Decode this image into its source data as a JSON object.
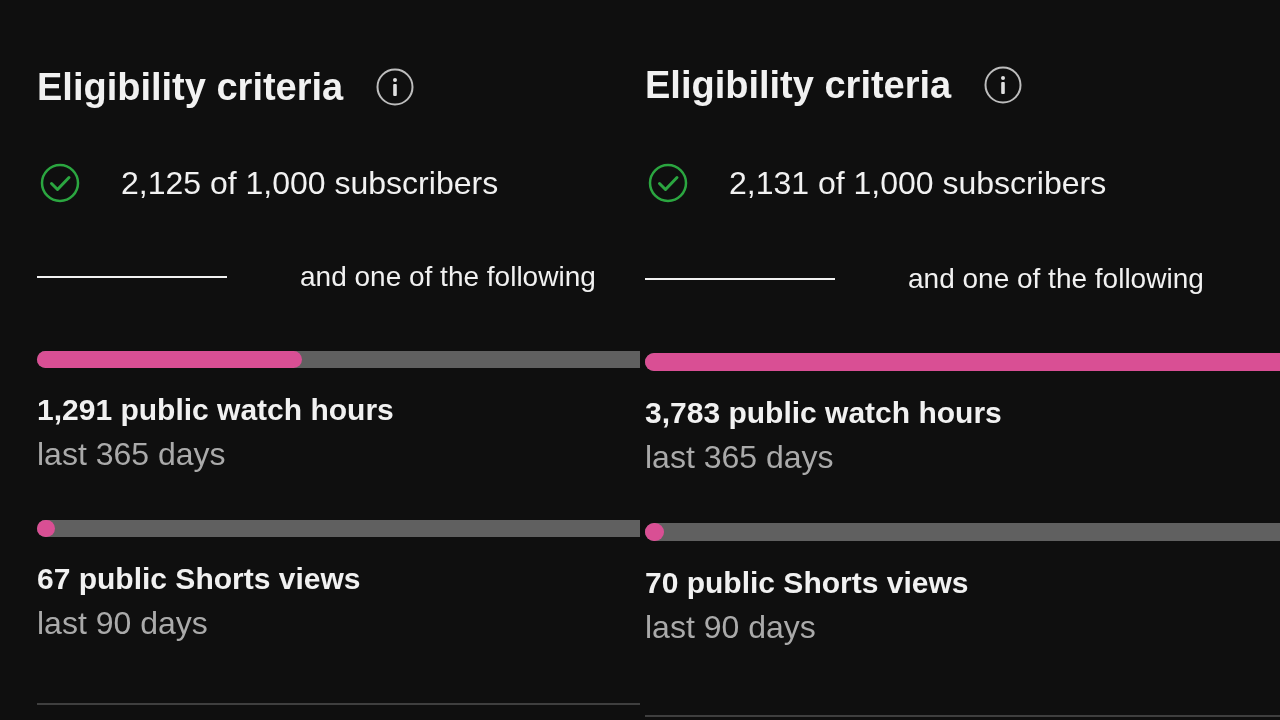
{
  "panels": [
    {
      "title": "Eligibility criteria",
      "requirement": {
        "text": "2,125 of 1,000 subscribers",
        "met": true
      },
      "separator_label": "and one of the following",
      "options": [
        {
          "label": "1,291 public watch hours",
          "period": "last 365 days",
          "level": 0.44
        },
        {
          "label": "67 public Shorts views",
          "period": "last 90 days",
          "level": 0.03
        }
      ]
    },
    {
      "title": "Eligibility criteria",
      "requirement": {
        "text": "2,131 of 1,000 subscribers",
        "met": true
      },
      "separator_label": "and one of the following",
      "options": [
        {
          "label": "3,783 public watch hours",
          "period": "last 365 days",
          "level": 1
        },
        {
          "label": "70 public Shorts views",
          "period": "last 90 days",
          "level": 0.03
        }
      ]
    }
  ]
}
